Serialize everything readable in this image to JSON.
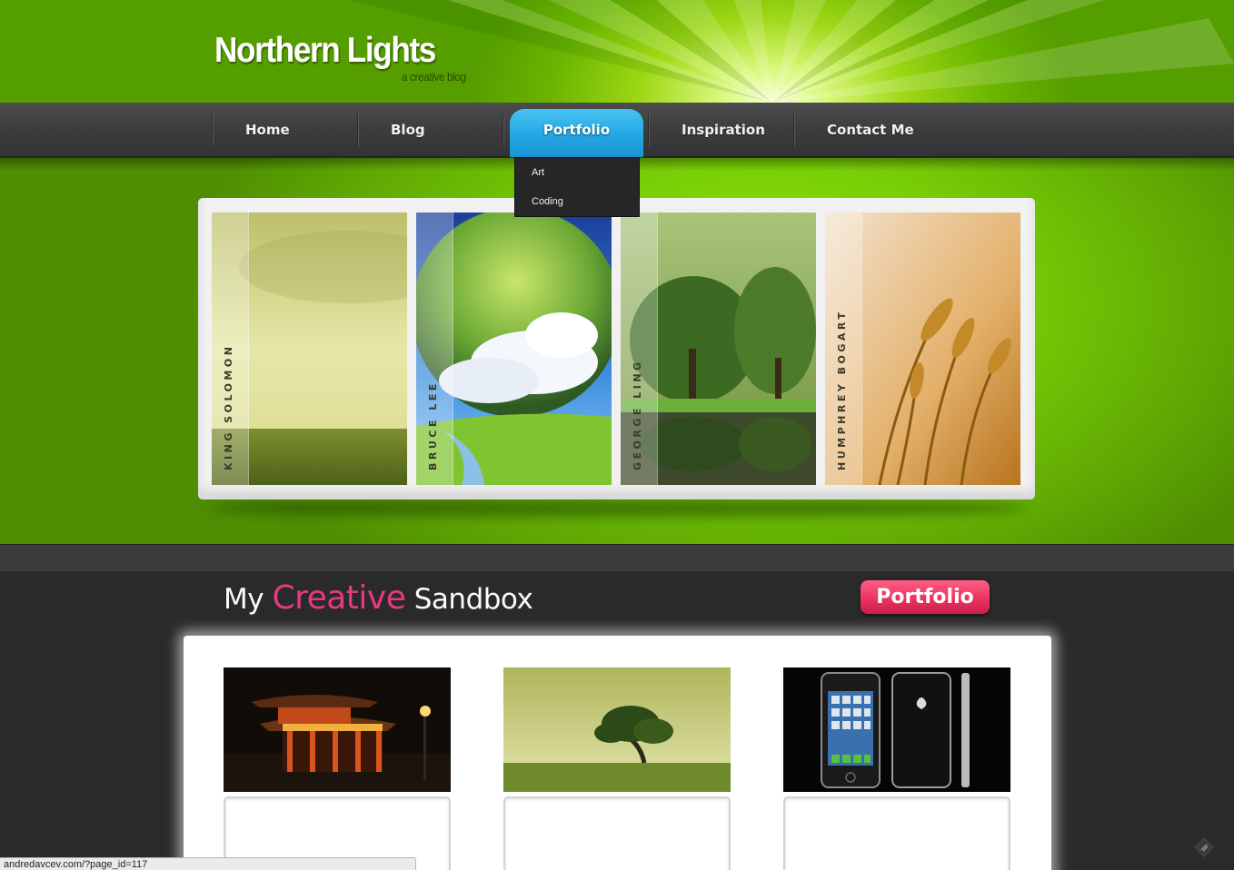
{
  "header": {
    "site_title": "Northern Lights",
    "tagline": "a creative blog"
  },
  "nav": {
    "items": [
      {
        "label": "Home"
      },
      {
        "label": "Blog"
      },
      {
        "label": "Portfolio",
        "active": true
      },
      {
        "label": "Inspiration"
      },
      {
        "label": "Contact Me"
      }
    ],
    "dropdown": [
      {
        "label": "Art"
      },
      {
        "label": "Coding"
      }
    ]
  },
  "slider": {
    "slides": [
      {
        "caption": "KING SOLOMON",
        "image": "meadow-haze-image"
      },
      {
        "caption": "BRUCE LEE",
        "image": "planet-landscape-image"
      },
      {
        "caption": "GEORGE LING",
        "image": "forest-lake-image"
      },
      {
        "caption": "HUMPHREY BOGART",
        "image": "wheat-field-image"
      }
    ]
  },
  "sandbox": {
    "title_prefix": "My",
    "title_accent": "Creative",
    "title_suffix": "Sandbox",
    "button_label": "Portfolio",
    "thumbnails": [
      {
        "image": "pagoda-night-image"
      },
      {
        "image": "windswept-tree-image"
      },
      {
        "image": "iphone-product-image"
      }
    ]
  },
  "status_bar": {
    "url": "andredavcev.com/?page_id=117"
  },
  "colors": {
    "header_green": "#69b400",
    "nav_dark": "#3e3e40",
    "nav_active_blue": "#23a6e3",
    "accent_pink": "#e8397e",
    "button_pink": "#e8305e",
    "page_dark": "#2a2a2b"
  }
}
